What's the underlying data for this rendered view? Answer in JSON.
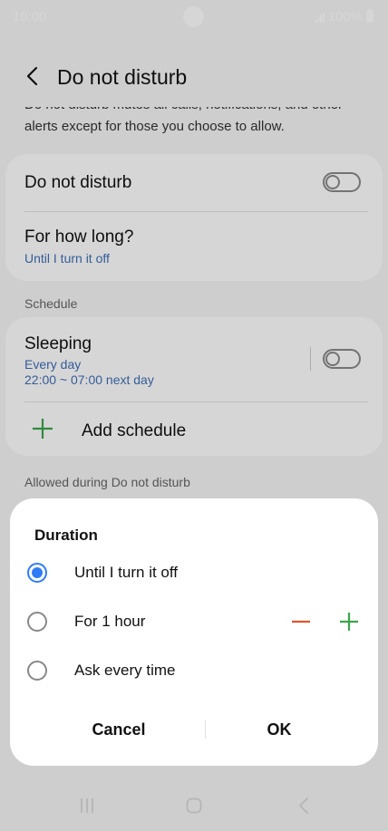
{
  "status_bar": {
    "time": "10:00",
    "battery": "100%"
  },
  "header": {
    "title": "Do not disturb"
  },
  "description": "Do not disturb mutes all calls, notifications, and other alerts except for those you choose to allow.",
  "main": {
    "dnd_label": "Do not disturb",
    "how_long_label": "For how long?",
    "how_long_value": "Until I turn it off",
    "schedule_header": "Schedule",
    "sleeping_label": "Sleeping",
    "sleeping_days": "Every day",
    "sleeping_time": "22:00 ~ 07:00 next day",
    "add_schedule_label": "Add schedule",
    "allowed_header": "Allowed during Do not disturb"
  },
  "dialog": {
    "title": "Duration",
    "options": [
      {
        "label": "Until I turn it off",
        "selected": true
      },
      {
        "label": "For 1 hour",
        "selected": false
      },
      {
        "label": "Ask every time",
        "selected": false
      }
    ],
    "cancel_label": "Cancel",
    "ok_label": "OK"
  },
  "colors": {
    "accent_blue": "#2f7df6",
    "subtext_blue": "#3e6fb7",
    "minus_orange": "#e5532d",
    "plus_green": "#3aa54a"
  },
  "icons": {
    "back": "chevron-left-icon",
    "plus": "plus-icon",
    "minus": "minus-icon",
    "nav_recent": "recent-apps-icon",
    "nav_home": "home-icon",
    "nav_back": "back-icon"
  }
}
